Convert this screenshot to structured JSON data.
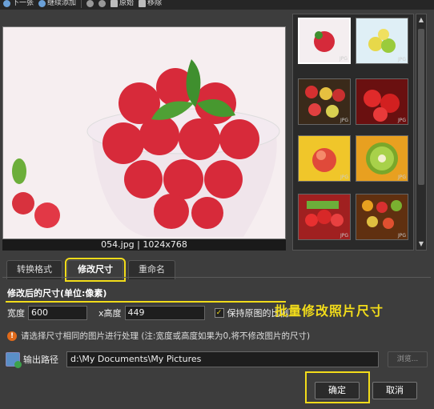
{
  "toolbar": {
    "next_label": "下一张",
    "continue_add_label": "继续添加",
    "original_label": "原始",
    "remove_label": "移除"
  },
  "preview": {
    "caption": "054.jpg | 1024x768"
  },
  "thumbnails": [
    {
      "tag": "JPG",
      "selected": true
    },
    {
      "tag": "JPG"
    },
    {
      "tag": "JPG"
    },
    {
      "tag": "JPG"
    },
    {
      "tag": "JPG"
    },
    {
      "tag": "JPG"
    },
    {
      "tag": "JPG"
    },
    {
      "tag": "JPG"
    }
  ],
  "tabs": [
    {
      "label": "转换格式"
    },
    {
      "label": "修改尺寸",
      "active": true
    },
    {
      "label": "重命名"
    }
  ],
  "resize": {
    "section_title": "修改后的尺寸(单位:像素)",
    "width_label": "宽度",
    "width_value": "600",
    "height_label": "x高度",
    "height_value": "449",
    "keep_ratio_label": "保持原图的比例",
    "keep_ratio_checked": "✓",
    "promo_text": "批量修改照片尺寸",
    "notice_text": "请选择尺寸相同的图片进行处理 (注:宽度或高度如果为0,将不修改图片的尺寸)",
    "warn_icon": "!"
  },
  "output": {
    "label": "输出路径",
    "path": "d:\\My Documents\\My Pictures",
    "browse_label": "浏览..."
  },
  "buttons": {
    "ok_label": "确定",
    "cancel_label": "取消"
  },
  "colors": {
    "highlight": "#f2dc1a",
    "background": "#3d3d3d"
  }
}
